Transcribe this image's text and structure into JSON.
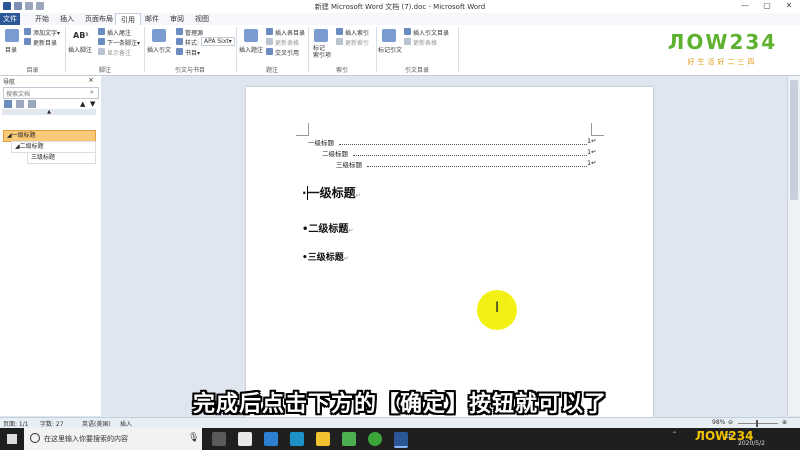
{
  "window": {
    "title": "新建 Microsoft Word 文档 (7).doc - Microsoft Word",
    "buttons": [
      "—",
      "▢",
      "✕"
    ]
  },
  "tabs": [
    {
      "label": "文件",
      "kind": "file"
    },
    {
      "label": "开始"
    },
    {
      "label": "插入"
    },
    {
      "label": "页面布局"
    },
    {
      "label": "引用",
      "kind": "active"
    },
    {
      "label": "邮件"
    },
    {
      "label": "审阅"
    },
    {
      "label": "视图"
    }
  ],
  "ribbon": {
    "toc_group": {
      "label": "目录",
      "big": "目录",
      "items": [
        "添加文字▾",
        "更新目录"
      ]
    },
    "footnote_group": {
      "label": "脚注",
      "big": "插入脚注",
      "items": [
        "插入尾注",
        "下一条脚注▾",
        "显示备注"
      ],
      "small_icon": "AB¹"
    },
    "citation_group": {
      "label": "引文与书目",
      "big": "插入引文",
      "items": [
        "管理源",
        "样式:",
        "书目▾"
      ],
      "style_value": "APA Sixt▾"
    },
    "caption_group": {
      "label": "题注",
      "big": "插入题注",
      "items": [
        "插入表目录",
        "更新表格",
        "交叉引用"
      ]
    },
    "index_group": {
      "label": "索引",
      "big": "标记\n索引项",
      "items": [
        "插入索引",
        "更新索引"
      ]
    },
    "authorities_group": {
      "label": "引文目录",
      "big": "标记引文",
      "items": [
        "插入引文目录",
        "更新表格"
      ]
    }
  },
  "logo": {
    "brand": "ЛОW234",
    "slogan": "好生活好二三四"
  },
  "nav_pane": {
    "title": "导航",
    "search_placeholder": "搜索文档",
    "tree": [
      {
        "label": "一级标题",
        "level": 1,
        "selected": true
      },
      {
        "label": "二级标题",
        "level": 2
      },
      {
        "label": "三级标题",
        "level": 3
      }
    ]
  },
  "document": {
    "toc": [
      {
        "text": "一级标题",
        "page": "1↵"
      },
      {
        "text": "二级标题",
        "page": "1↵"
      },
      {
        "text": "三级标题",
        "page": "1↵"
      }
    ],
    "headings": [
      {
        "text": "一级标题",
        "mark": "↵",
        "size": "h1"
      },
      {
        "text": "二级标题",
        "mark": "↵",
        "size": "h2"
      },
      {
        "text": "三级标题",
        "mark": "↵",
        "size": "h3"
      }
    ]
  },
  "subtitle": "完成后点击下方的【确定】按钮就可以了",
  "status_bar": {
    "page": "页面: 1/1",
    "words": "字数: 27",
    "lang": "英语(美国)",
    "mode": "插入",
    "zoom": "98%",
    "zoom_minus": "⊖",
    "zoom_plus": "⊕"
  },
  "taskbar": {
    "search_placeholder": "在这里输入你要搜索的内容",
    "date": "2020/5/2",
    "ime": "中"
  },
  "colors": {
    "file_tab": "#2b5797",
    "highlight": "#f3f000",
    "nav_selected": "#f8c978",
    "logo_orange": "#e39b1b",
    "logo_green": "#5fb130",
    "logo_blue": "#2d7fd1"
  }
}
